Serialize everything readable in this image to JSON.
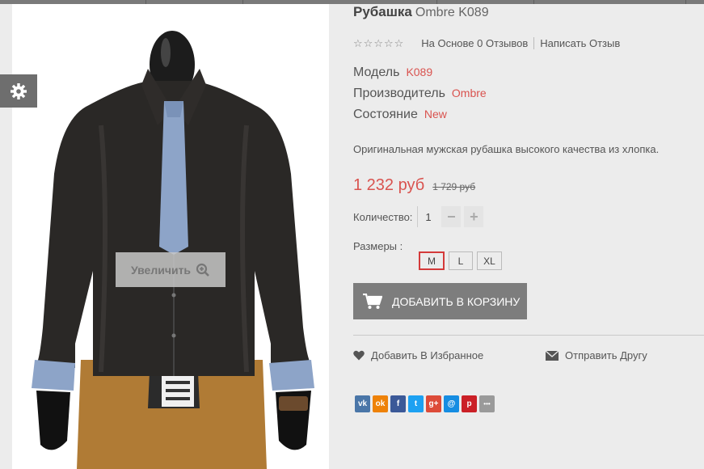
{
  "product": {
    "name_bold": "Рубашка",
    "name_rest": "Ombre K089",
    "reviews_text": "На Основе 0 Отзывов",
    "write_review": "Написать Отзыв",
    "specs": [
      {
        "label": "Модель",
        "value": "K089"
      },
      {
        "label": "Производитель",
        "value": "Ombre"
      },
      {
        "label": "Состояние",
        "value": "New"
      }
    ],
    "description": "Оригинальная мужская рубашка высокого качества из хлопка.",
    "price_new": "1 232 руб",
    "price_old": "1 729 руб",
    "quantity_label": "Количество:",
    "quantity_value": "1",
    "minus": "−",
    "plus": "+",
    "sizes_label": "Размеры :",
    "sizes": [
      "M",
      "L",
      "XL"
    ],
    "add_to_cart": "ДОБАВИТЬ В КОРЗИНУ",
    "wishlist": "Добавить В Избранное",
    "send_friend": "Отправить Другу",
    "zoom": "Увеличить"
  },
  "share_buttons": [
    {
      "name": "vk",
      "glyph": "vk",
      "color": "#4a76a8"
    },
    {
      "name": "odnoklassniki",
      "glyph": "ok",
      "color": "#ee8208"
    },
    {
      "name": "facebook",
      "glyph": "f",
      "color": "#3b5998"
    },
    {
      "name": "twitter",
      "glyph": "t",
      "color": "#1da1f2"
    },
    {
      "name": "googleplus",
      "glyph": "g+",
      "color": "#dd4b39"
    },
    {
      "name": "mailru",
      "glyph": "@",
      "color": "#168de2"
    },
    {
      "name": "pinterest",
      "glyph": "p",
      "color": "#cb2027"
    },
    {
      "name": "more",
      "glyph": "•••",
      "color": "#9a9a9a"
    }
  ],
  "colors": {
    "accent": "#d9534f",
    "button": "#7d7d7d"
  }
}
